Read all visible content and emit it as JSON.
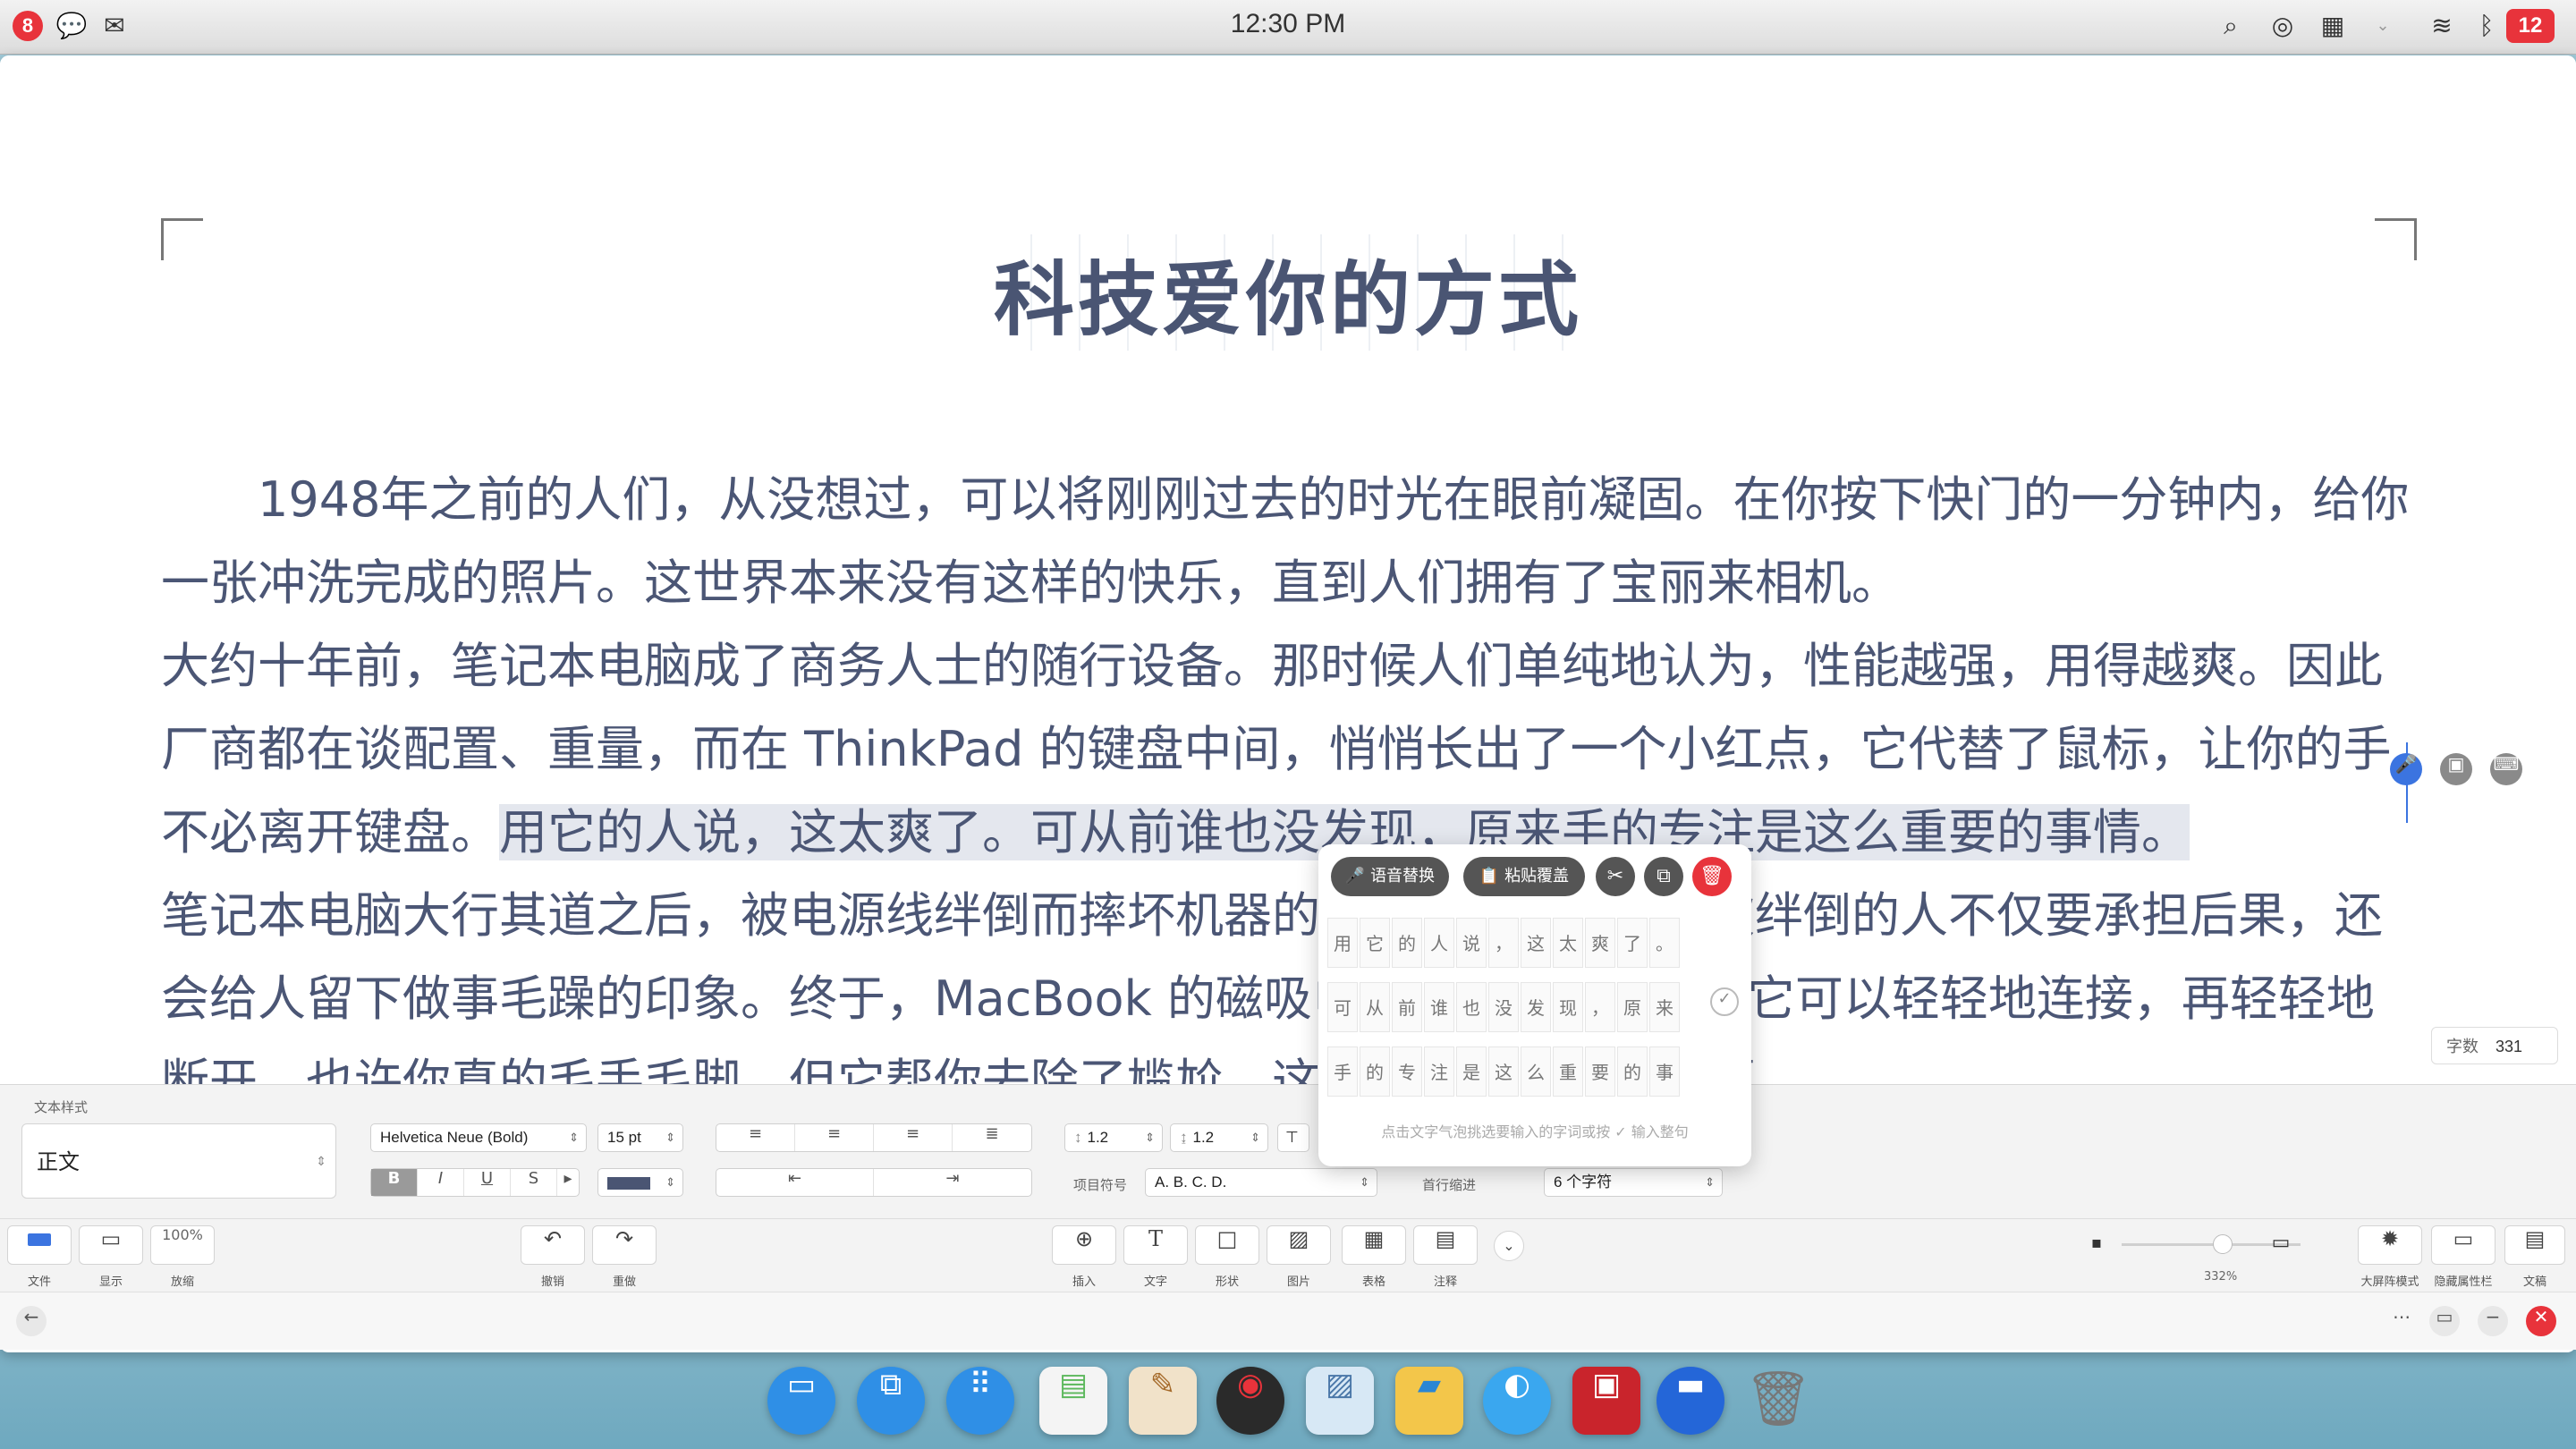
{
  "menubar": {
    "app_badge": "8",
    "clock": "12:30 PM",
    "notification_count": "12"
  },
  "document": {
    "title": "科技爱你的方式",
    "p1": "　　1948年之前的人们，从没想过，可以将刚刚过去的时光在眼前凝固。在你按下快门的一分钟内，给你一张冲洗完成的照片。这世界本来没有这样的快乐，直到人们拥有了宝丽来相机。",
    "p2_before": "大约十年前，笔记本电脑成了商务人士的随行设备。那时候人们单纯地认为，性能越强，用得越爽。因此厂商都在谈配置、重量，而在 ThinkPad 的键盘中间，悄悄长出了一个小红点，它代替了鼠标，让你的手不必离开键盘。",
    "p2_selected": "用它的人说，这太爽了。可从前谁也没发现，原来手的专注是这么重要的事情。",
    "p3": "笔记本电脑大行其道之后，被电源线绊倒而摔坏机器的事情也常有发生。被绊倒的人不仅要承担后果，还会给人留下做事毛躁的印象。终于，MacBook 的磁吸电源改变了这一切，它可以轻轻地连接，再轻轻地断开。也许你真的毛手毛脚，但它帮你去除了尴尬，这本来就不是你的问题。",
    "word_count_label": "字数",
    "word_count": "331"
  },
  "popup": {
    "voice_replace": "语音替换",
    "paste_cover": "粘贴覆盖",
    "row1": [
      "用",
      "它",
      "的",
      "人",
      "说",
      "，",
      "这",
      "太",
      "爽",
      "了",
      "。"
    ],
    "row2": [
      "可",
      "从",
      "前",
      "谁",
      "也",
      "没",
      "发",
      "现",
      "，",
      "原",
      "来"
    ],
    "row3": [
      "手",
      "的",
      "专",
      "注",
      "是",
      "这",
      "么",
      "重",
      "要",
      "的",
      "事"
    ],
    "hint": "点击文字气泡挑选要输入的字词或按 ✓ 输入整句"
  },
  "inspector": {
    "text_style_label": "文本样式",
    "paragraph_style": "正文",
    "font_name": "Helvetica Neue (Bold)",
    "font_size": "15 pt",
    "line_spacing_1": "1.2",
    "line_spacing_2": "1.2",
    "bullet_label": "项目符号",
    "bullet_value": "A. B. C. D.",
    "indent_label": "首行缩进",
    "indent_value": "6 个字符",
    "bold": "B",
    "italic": "I",
    "underline": "U",
    "strike": "S",
    "text_color": "#4a5573"
  },
  "toolbar": {
    "file": "文件",
    "view": "显示",
    "zoom_value": "100%",
    "zoom": "放缩",
    "undo": "撤销",
    "redo": "重做",
    "insert": "插入",
    "text": "文字",
    "shape": "形状",
    "image": "图片",
    "table": "表格",
    "comment": "注释",
    "zoom_percent": "332%",
    "big_mode": "大屏阵模式",
    "hide_props": "隐藏属性栏",
    "doc": "文稿"
  },
  "colors": {
    "accent_red": "#e8333b",
    "text_blue_gray": "#4b5675",
    "selection": "#e4e7ee"
  }
}
